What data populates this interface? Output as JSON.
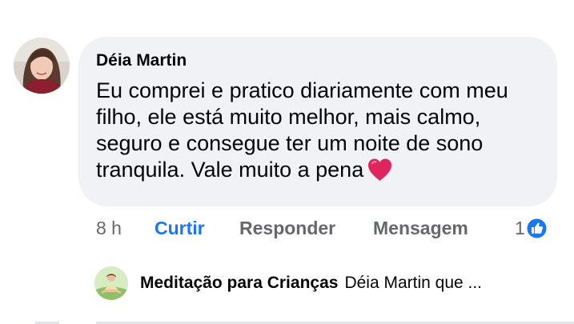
{
  "comment": {
    "author": "Déia Martin",
    "text": "Eu comprei e pratico diariamente com meu filho, ele está muito melhor, mais calmo, seguro e consegue ter um noite de sono tranquila. Vale muito a pena",
    "emoji": "heart-icon",
    "time": "8 h",
    "actions": {
      "like": "Curtir",
      "reply": "Responder",
      "message": "Mensagem"
    },
    "reaction_count": "1",
    "reaction_type": "like-icon"
  },
  "reply_preview": {
    "author": "Meditação para Crianças",
    "text": "Déia Martin que ..."
  },
  "colors": {
    "bubble": "#f0f2f5",
    "link_blue": "#1877f2",
    "secondary_text": "#65676b",
    "heart_red": "#e0245e"
  }
}
